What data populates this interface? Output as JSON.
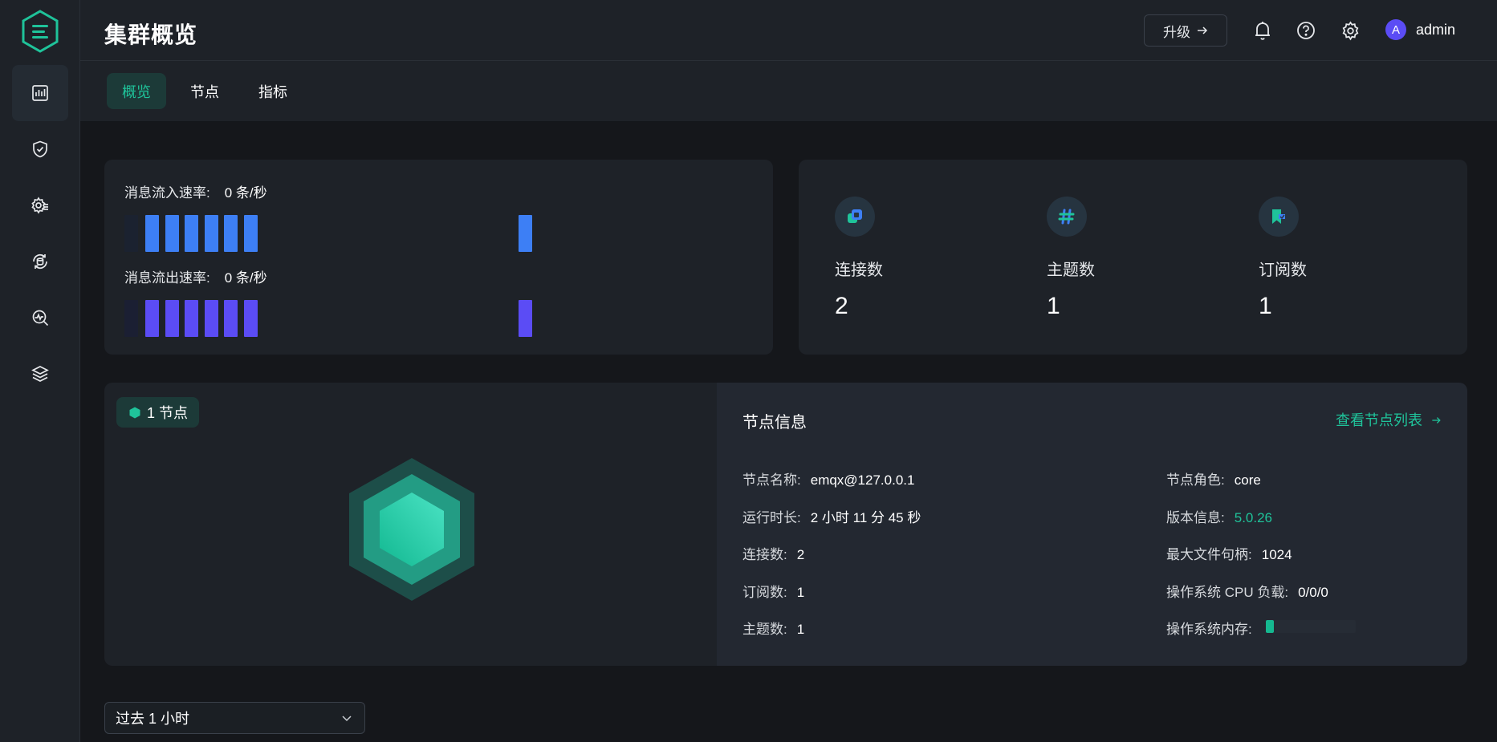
{
  "header": {
    "title": "集群概览",
    "upgrade_label": "升级",
    "user": {
      "initial": "A",
      "name": "admin"
    }
  },
  "sidebar": {
    "items": [
      {
        "icon": "dashboard-chart-icon",
        "active": true
      },
      {
        "icon": "shield-check-icon",
        "active": false
      },
      {
        "icon": "gear-list-icon",
        "active": false
      },
      {
        "icon": "data-integration-icon",
        "active": false
      },
      {
        "icon": "diagnose-search-icon",
        "active": false
      },
      {
        "icon": "layers-icon",
        "active": false
      }
    ]
  },
  "tabs": [
    "概览",
    "节点",
    "指标"
  ],
  "rates": {
    "in_label": "消息流入速率:",
    "in_value": "0 条/秒",
    "out_label": "消息流出速率:",
    "out_value": "0 条/秒",
    "in_color": "#3d7ff5",
    "out_color": "#5b4cf5"
  },
  "stats": [
    {
      "label": "连接数",
      "value": "2",
      "icon": "connections-icon"
    },
    {
      "label": "主题数",
      "value": "1",
      "icon": "topic-hash-icon"
    },
    {
      "label": "订阅数",
      "value": "1",
      "icon": "subscription-icon"
    }
  ],
  "node_badge": "1 节点",
  "node_info": {
    "title": "节点信息",
    "view_link": "查看节点列表",
    "left": [
      {
        "label": "节点名称:",
        "value": "emqx@127.0.0.1"
      },
      {
        "label": "运行时长:",
        "value": "2 小时 11 分 45 秒"
      },
      {
        "label": "连接数:",
        "value": "2"
      },
      {
        "label": "订阅数:",
        "value": "1"
      },
      {
        "label": "主题数:",
        "value": "1"
      }
    ],
    "right": [
      {
        "label": "节点角色:",
        "value": "core"
      },
      {
        "label": "版本信息:",
        "value": "5.0.26"
      },
      {
        "label": "最大文件句柄:",
        "value": "1024"
      },
      {
        "label": "操作系统 CPU 负载:",
        "value": "0/0/0"
      },
      {
        "label": "操作系统内存:",
        "value": ""
      }
    ],
    "memory_usage_fraction": 0.09
  },
  "time_range": {
    "selected": "过去 1 小时"
  },
  "colors": {
    "accent": "#1fc39a",
    "background": "#15171b",
    "card": "#1e2228"
  }
}
